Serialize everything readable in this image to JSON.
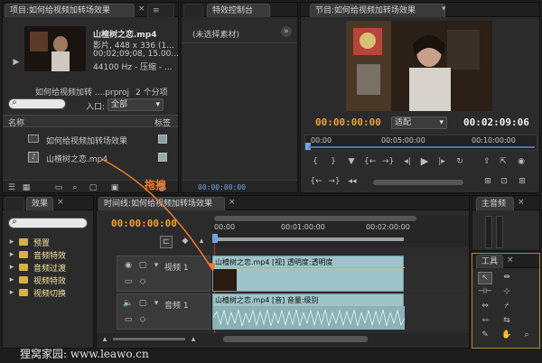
{
  "project": {
    "tab": "项目:如何给视频加转场效果",
    "tab_close": "×",
    "tab_menu": "≡",
    "clip_name": "山楂树之恋.mp4",
    "clip_info1": "影片, 448 x 336 (1...",
    "clip_info2": "00;02;09;08, 15.00...",
    "clip_info3": "44100 Hz - 压缩 - ...",
    "project_file": "如何给视频加转 ....prproj",
    "item_count": "2 个分项",
    "entry_label": "入口:",
    "entry_value": "全部",
    "col_name": "名称",
    "col_label": "标签",
    "items": [
      "如何给视频加转场效果",
      "山楂树之恋.mp4"
    ]
  },
  "effect_controls": {
    "tab": "特效控制台",
    "no_clip": "(未选择素材)",
    "time": "00:00:00:00"
  },
  "program": {
    "tab": "节目:如何给视频加转场效果",
    "timecode": "00:00:00:00",
    "fit": "适配",
    "duration": "00:02:09:06",
    "ruler": [
      "00:00",
      "00:05:00:00",
      "00:10:00:00"
    ]
  },
  "effects": {
    "tab": "效果",
    "folders": [
      "预置",
      "音频特效",
      "音频过渡",
      "视频特效",
      "视频切换"
    ]
  },
  "timeline": {
    "tab": "时间线:如何给视频加转场效果",
    "timecode": "00:00:00:00",
    "ruler": [
      "00:00",
      "00:01:00:00",
      "00:02:00:00"
    ],
    "video_track": "视频 1",
    "audio_track": "音频 1",
    "video_clip": "山楂树之恋.mp4 [视] 透明度:透明度",
    "audio_clip": "山楂树之恋.mp4 [音] 音量:级别"
  },
  "audio_master": {
    "tab": "主音频"
  },
  "tools": {
    "tab": "工具"
  },
  "annotation": {
    "drag_label": "拖拽",
    "arrow_color": "#f07a2a"
  },
  "watermark": "狸窝家园: www.leawo.cn"
}
